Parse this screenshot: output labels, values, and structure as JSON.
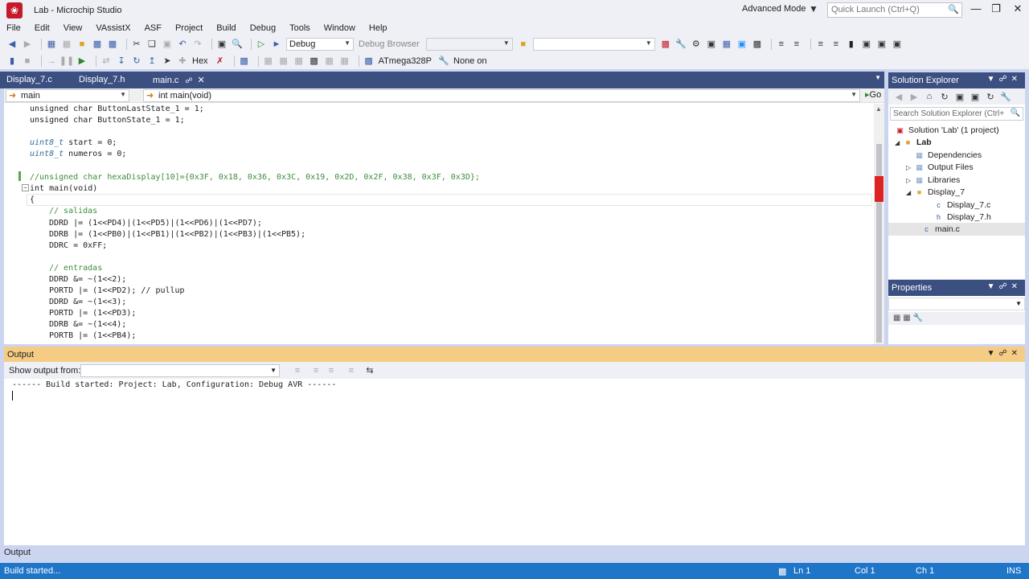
{
  "window": {
    "title": "Lab - Microchip Studio",
    "advanced_mode": "Advanced Mode",
    "quick_launch_placeholder": "Quick Launch (Ctrl+Q)"
  },
  "menu": [
    "File",
    "Edit",
    "View",
    "VAssistX",
    "ASF",
    "Project",
    "Build",
    "Debug",
    "Tools",
    "Window",
    "Help"
  ],
  "toolbar": {
    "config": "Debug",
    "debug_browser": "Debug Browser",
    "hex": "Hex",
    "device": "ATmega328P",
    "tool": "None on"
  },
  "tabs": [
    {
      "label": "Display_7.c"
    },
    {
      "label": "Display_7.h"
    },
    {
      "label": "main.c"
    }
  ],
  "navbar": {
    "scope": "main",
    "member": "int main(void)",
    "go": "Go"
  },
  "code_lines": [
    {
      "id": "l1",
      "text": "unsigned char ButtonLastState_1 = 1;"
    },
    {
      "id": "l2",
      "text": "unsigned char ButtonState_1 = 1;"
    },
    {
      "id": "l3",
      "type": "uint8_t",
      "rest": " start = 0;"
    },
    {
      "id": "l4",
      "type": "uint8_t",
      "rest": " numeros = 0;"
    },
    {
      "id": "l5",
      "text": "//unsigned char hexaDisplay[10]={0x3F, 0x18, 0x36, 0x3C, 0x19, 0x2D, 0x2F, 0x38, 0x3F, 0x3D};"
    },
    {
      "id": "l6",
      "text": "int main(void)"
    },
    {
      "id": "l7",
      "text": "{"
    },
    {
      "id": "l8",
      "text": "// salidas"
    },
    {
      "id": "l9",
      "text": "DDRD |= (1<<PD4)|(1<<PD5)|(1<<PD6)|(1<<PD7);"
    },
    {
      "id": "l10",
      "text": "DDRB |= (1<<PB0)|(1<<PB1)|(1<<PB2)|(1<<PB3)|(1<<PB5);"
    },
    {
      "id": "l11",
      "text": "DDRC = 0xFF;"
    },
    {
      "id": "l12",
      "text": "// entradas"
    },
    {
      "id": "l13",
      "text": "DDRD &= ~(1<<2);"
    },
    {
      "id": "l14",
      "text": "PORTD |= (1<<PD2); // pullup"
    },
    {
      "id": "l15",
      "text": "DDRD &= ~(1<<3);"
    },
    {
      "id": "l16",
      "text": "PORTD |= (1<<PD3);"
    },
    {
      "id": "l17",
      "text": "DDRB &= ~(1<<4);"
    },
    {
      "id": "l18",
      "text": "PORTB |= (1<<PB4);"
    }
  ],
  "solution_explorer": {
    "title": "Solution Explorer",
    "search_placeholder": "Search Solution Explorer (Ctrl+",
    "items": [
      {
        "label": "Solution 'Lab' (1 project)"
      },
      {
        "label": "Lab"
      },
      {
        "label": "Dependencies"
      },
      {
        "label": "Output Files"
      },
      {
        "label": "Libraries"
      },
      {
        "label": "Display_7"
      },
      {
        "label": "Display_7.c"
      },
      {
        "label": "Display_7.h"
      },
      {
        "label": "main.c"
      }
    ]
  },
  "properties": {
    "title": "Properties"
  },
  "output": {
    "title": "Output",
    "show_from_label": "Show output from:",
    "text": "------ Build started: Project: Lab, Configuration: Debug AVR ------",
    "bottom_tab": "Output"
  },
  "status": {
    "message": "Build started...",
    "ln": "Ln 1",
    "col": "Col 1",
    "ch": "Ch 1",
    "mode": "INS"
  },
  "colors": {
    "accent": "#3b4f81",
    "status_bar": "#1f75c8",
    "active_tab": "#f5cc84",
    "comment": "#3c8d3c"
  }
}
